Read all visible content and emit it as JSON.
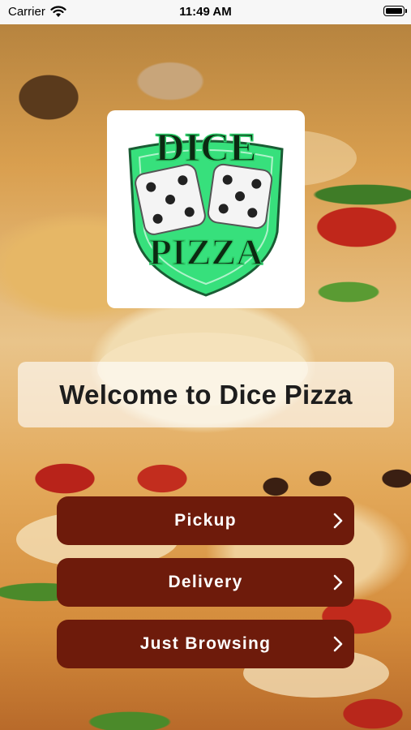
{
  "status_bar": {
    "carrier": "Carrier",
    "time": "11:49 AM"
  },
  "logo": {
    "word_top": "DICE",
    "word_bottom": "PIZZA",
    "shield_color": "#37e07c"
  },
  "welcome": {
    "text": "Welcome to Dice Pizza"
  },
  "buttons": [
    {
      "label": "Pickup",
      "icon": "chevron-right-icon"
    },
    {
      "label": "Delivery",
      "icon": "chevron-right-icon"
    },
    {
      "label": "Just Browsing",
      "icon": "chevron-right-icon"
    }
  ],
  "colors": {
    "button_bg": "#6e1b0b",
    "button_text": "#ffffff",
    "welcome_text": "#1d1d1d"
  }
}
